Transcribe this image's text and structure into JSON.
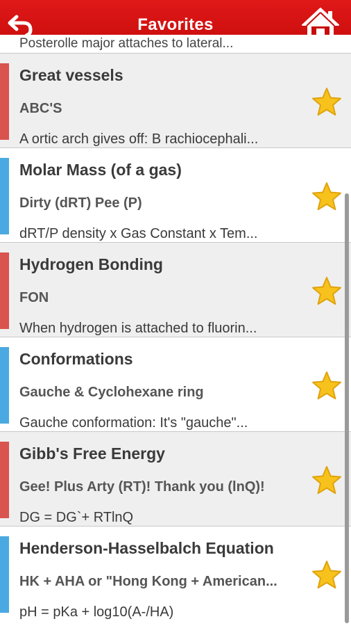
{
  "header": {
    "title": "Favorites",
    "accent_color": "#d41010",
    "back_icon": "back-arrow-icon",
    "home_icon": "home-icon"
  },
  "partial_top_text": "Posterolle major attaches to lateral...",
  "items": [
    {
      "name": "Great vessels",
      "mnemonic": "ABC'S",
      "description": "A ortic arch gives off: B rachiocephali...",
      "bar_color": "#d9534f",
      "favorite": true
    },
    {
      "name": "Molar Mass (of a gas)",
      "mnemonic": "Dirty (dRT) Pee (P)",
      "description": "dRT/P density x Gas Constant x Tem...",
      "bar_color": "#4aa9e0",
      "favorite": true
    },
    {
      "name": "Hydrogen Bonding",
      "mnemonic": "FON",
      "description": "When hydrogen is attached to fluorin...",
      "bar_color": "#d9534f",
      "favorite": true
    },
    {
      "name": "Conformations",
      "mnemonic": "Gauche & Cyclohexane ring",
      "description": "Gauche conformation: It's \"gauche\"...",
      "bar_color": "#4aa9e0",
      "favorite": true
    },
    {
      "name": "Gibb's Free Energy",
      "mnemonic": "Gee! Plus Arty (RT)! Thank you (lnQ)!",
      "description": "DG = DG`+ RTlnQ",
      "bar_color": "#d9534f",
      "favorite": true
    },
    {
      "name": "Henderson-Hasselbalch Equation",
      "mnemonic": "HK + AHA or \"Hong Kong + American...",
      "description": "pH = pKa + log10(A-/HA)",
      "bar_color": "#4aa9e0",
      "favorite": true
    }
  ]
}
